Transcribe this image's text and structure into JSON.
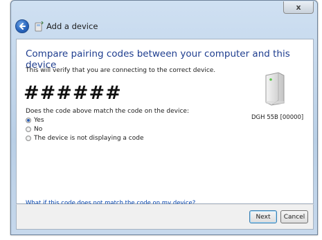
{
  "window": {
    "title": "Add a device",
    "close_glyph": "x"
  },
  "content": {
    "heading": "Compare pairing codes between your computer and this device",
    "description": "This will verify that you are connecting to the correct device.",
    "code": "######",
    "question": "Does the code above match the code on the device:",
    "options": [
      {
        "label": "Yes",
        "selected": true
      },
      {
        "label": "No",
        "selected": false
      },
      {
        "label": "The device is not displaying a code",
        "selected": false
      }
    ],
    "device_label": "DGH 55B [00000]",
    "help_link": "What if this code does not match the code on my device?"
  },
  "footer": {
    "next_label": "Next",
    "cancel_label": "Cancel"
  },
  "colors": {
    "heading": "#1e3d8f",
    "link": "#0645ad",
    "accent": "#2a67bf"
  },
  "icons": {
    "back": "back-arrow-icon",
    "wizard": "bluetooth-device-icon",
    "device": "device-tower-icon"
  }
}
